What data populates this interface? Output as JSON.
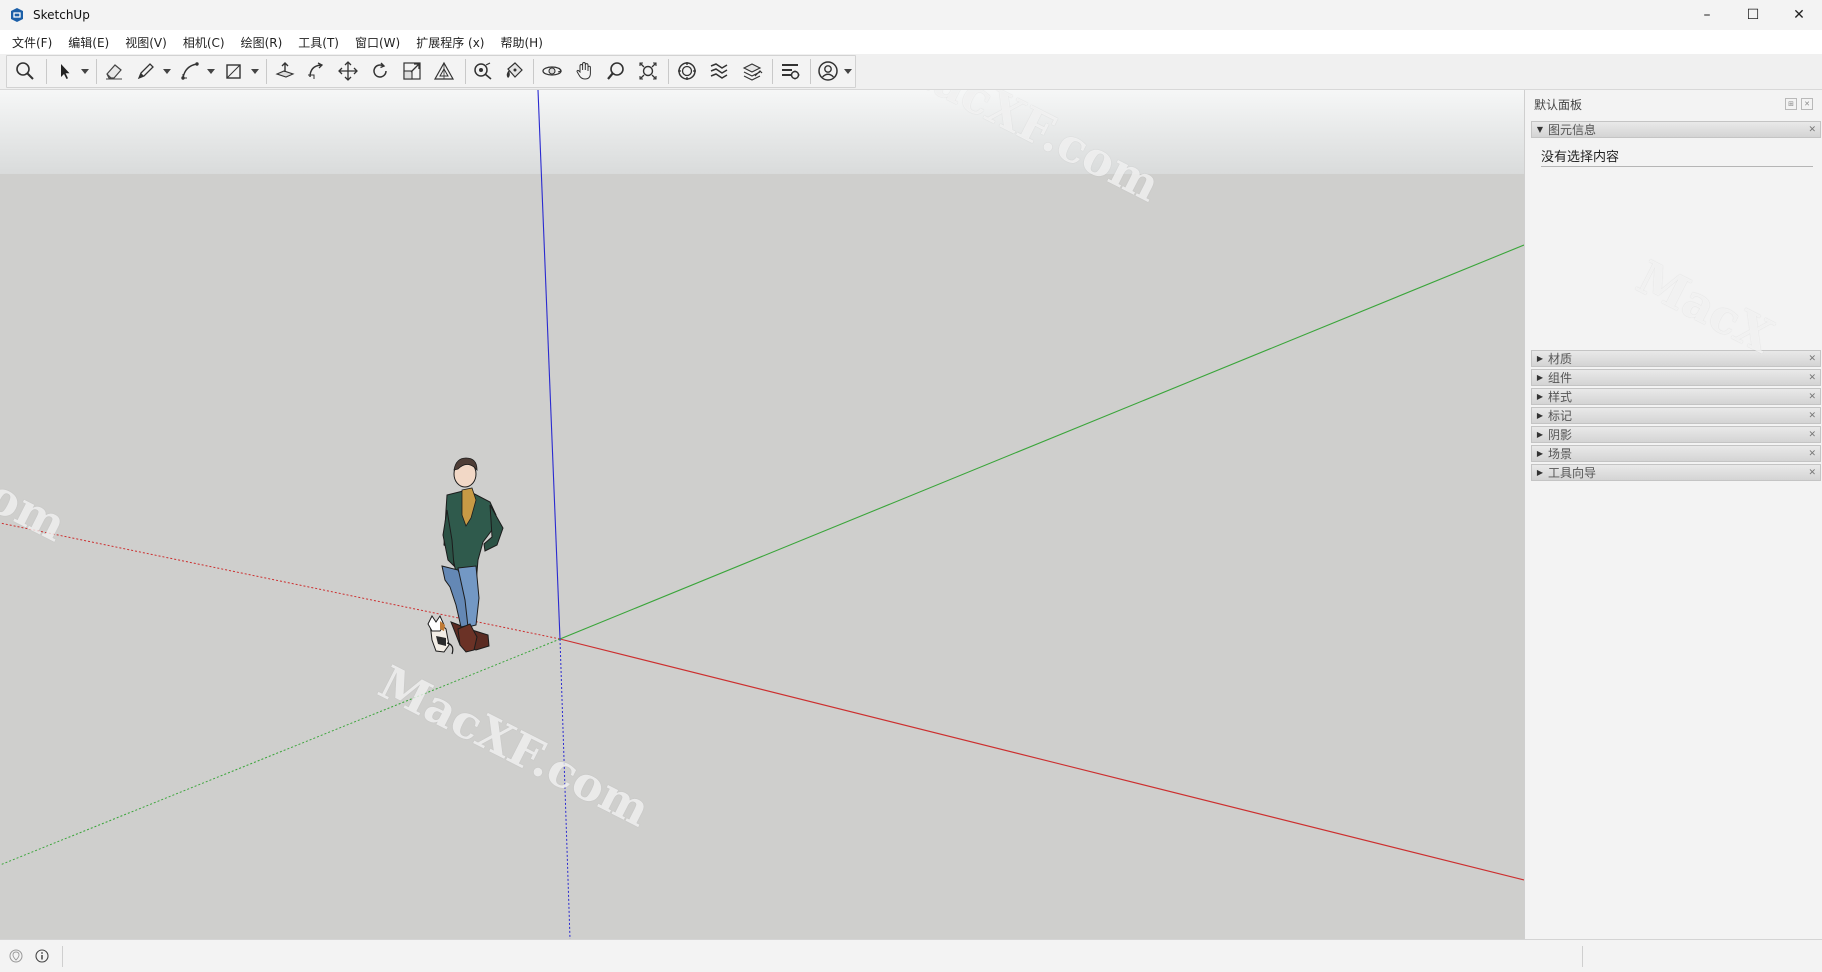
{
  "window": {
    "title": "SketchUp",
    "controls": {
      "minimize": "–",
      "maximize": "☐",
      "close": "✕"
    }
  },
  "menu": {
    "items": [
      "文件(F)",
      "编辑(E)",
      "视图(V)",
      "相机(C)",
      "绘图(R)",
      "工具(T)",
      "窗口(W)",
      "扩展程序 (x)",
      "帮助(H)"
    ]
  },
  "toolbar": {
    "tools": [
      "search-icon",
      "select-icon",
      "eraser-icon",
      "pencil-icon",
      "arc-icon",
      "rectangle-icon",
      "push-pull-icon",
      "follow-me-icon",
      "move-icon",
      "rotate-icon",
      "scale-icon",
      "offset-icon",
      "tape-measure-icon",
      "paint-bucket-icon",
      "orbit-icon",
      "pan-icon",
      "zoom-icon",
      "zoom-extents-icon",
      "warehouse-icon",
      "extension-warehouse-icon",
      "layout-icon",
      "extension-manager-icon",
      "account-icon"
    ]
  },
  "viewport": {
    "background": "#cfcfcd",
    "sky_top": "#f6f7f7",
    "sky_bottom": "#d9dbdb",
    "axis_colors": {
      "red": "#cc2f2f",
      "green": "#3aa53a",
      "blue": "#2a2ad0"
    }
  },
  "panel": {
    "title": "默认面板",
    "entity_info": {
      "label": "图元信息",
      "content": "没有选择内容"
    },
    "trays": [
      "材质",
      "组件",
      "样式",
      "标记",
      "阴影",
      "场景",
      "工具向导"
    ]
  },
  "watermark": {
    "text1": "MacXF.com",
    "text2": "MacXF.com",
    "text3": "MacX",
    "text4": "om"
  }
}
